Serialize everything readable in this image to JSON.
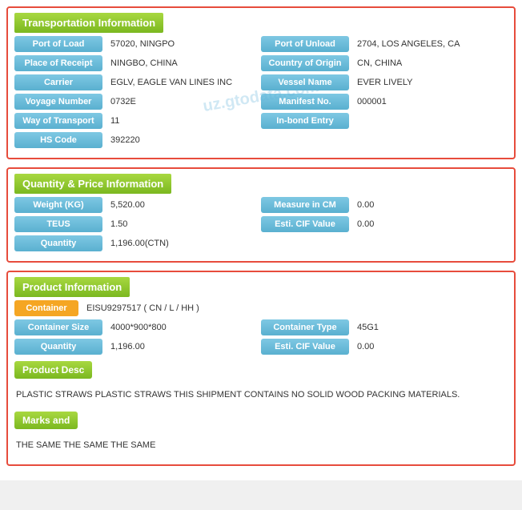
{
  "transportation": {
    "header": "Transportation Information",
    "fields": [
      {
        "left_label": "Port of Load",
        "left_value": "57020, NINGPO",
        "right_label": "Port of Unload",
        "right_value": "2704, LOS ANGELES, CA"
      },
      {
        "left_label": "Place of Receipt",
        "left_value": "NINGBO, CHINA",
        "right_label": "Country of Origin",
        "right_value": "CN, CHINA"
      },
      {
        "left_label": "Carrier",
        "left_value": "EGLV, EAGLE VAN LINES INC",
        "right_label": "Vessel Name",
        "right_value": "EVER LIVELY"
      },
      {
        "left_label": "Voyage Number",
        "left_value": "0732E",
        "right_label": "Manifest No.",
        "right_value": "000001"
      },
      {
        "left_label": "Way of Transport",
        "left_value": "11",
        "right_label": "In-bond Entry",
        "right_value": ""
      },
      {
        "left_label": "HS Code",
        "left_value": "392220",
        "right_label": "",
        "right_value": ""
      }
    ]
  },
  "quantity": {
    "header": "Quantity & Price Information",
    "fields": [
      {
        "left_label": "Weight (KG)",
        "left_value": "5,520.00",
        "right_label": "Measure in CM",
        "right_value": "0.00"
      },
      {
        "left_label": "TEUS",
        "left_value": "1.50",
        "right_label": "Esti. CIF Value",
        "right_value": "0.00"
      },
      {
        "left_label": "Quantity",
        "left_value": "1,196.00(CTN)",
        "right_label": "",
        "right_value": ""
      }
    ]
  },
  "product": {
    "header": "Product Information",
    "container_label": "Container",
    "container_value": "EISU9297517 ( CN / L / HH )",
    "fields": [
      {
        "left_label": "Container Size",
        "left_value": "4000*900*800",
        "right_label": "Container Type",
        "right_value": "45G1"
      },
      {
        "left_label": "Quantity",
        "left_value": "1,196.00",
        "right_label": "Esti. CIF Value",
        "right_value": "0.00"
      }
    ],
    "product_desc_label": "Product Desc",
    "product_desc_text": "PLASTIC STRAWS PLASTIC STRAWS THIS SHIPMENT CONTAINS NO SOLID WOOD PACKING MATERIALS.",
    "marks_label": "Marks and",
    "marks_text": "THE SAME THE SAME THE SAME"
  },
  "watermark": "uz.gtodata.com"
}
